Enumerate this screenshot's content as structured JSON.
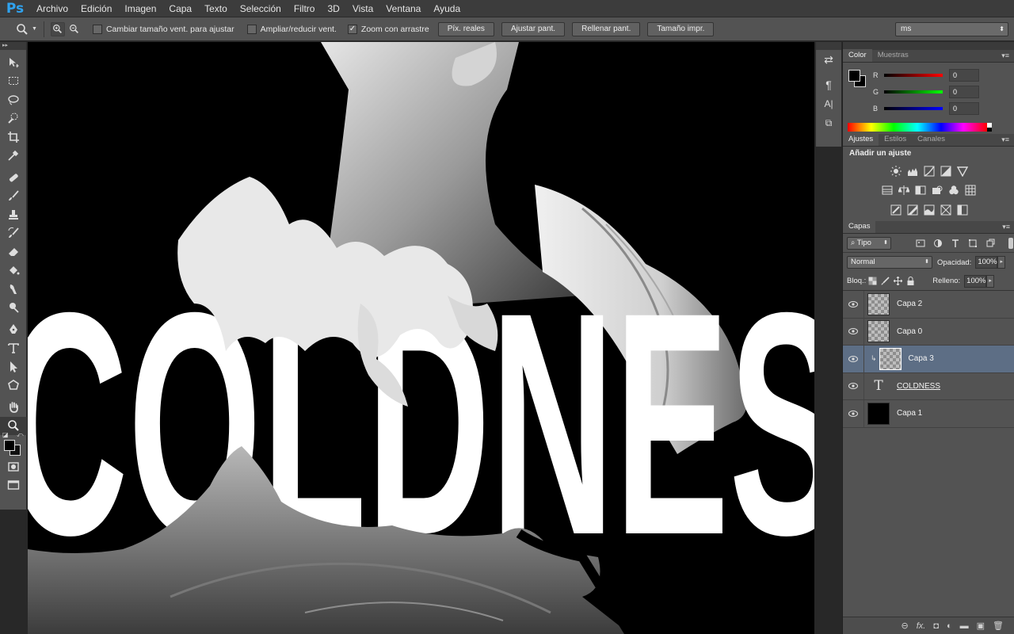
{
  "app": {
    "logo": "Ps"
  },
  "menu": [
    "Archivo",
    "Edición",
    "Imagen",
    "Capa",
    "Texto",
    "Selección",
    "Filtro",
    "3D",
    "Vista",
    "Ventana",
    "Ayuda"
  ],
  "options": {
    "resize_windows": "Cambiar tamaño vent. para ajustar",
    "zoom_all": "Ampliar/reducir vent.",
    "scrubby_zoom": "Zoom con arrastre",
    "buttons": [
      "Píx. reales",
      "Ajustar pant.",
      "Rellenar pant.",
      "Tamaño impr."
    ],
    "workspace_value": "ms"
  },
  "canvas_text": "COLDNES",
  "color_panel": {
    "tabs": [
      "Color",
      "Muestras"
    ],
    "channels": [
      {
        "label": "R",
        "value": "0"
      },
      {
        "label": "G",
        "value": "0"
      },
      {
        "label": "B",
        "value": "0"
      }
    ]
  },
  "adjust_panel": {
    "tabs": [
      "Ajustes",
      "Estilos",
      "Canales"
    ],
    "title": "Añadir un ajuste"
  },
  "layers_panel": {
    "tab": "Capas",
    "filter": "Tipo",
    "blend_mode": "Normal",
    "opacity_label": "Opacidad:",
    "opacity": "100%",
    "lock_label": "Bloq.:",
    "fill_label": "Relleno:",
    "fill": "100%",
    "layers": [
      {
        "name": "Capa 2",
        "kind": "pixel",
        "selected": false
      },
      {
        "name": "Capa 0",
        "kind": "pixel",
        "selected": false
      },
      {
        "name": "Capa 3",
        "kind": "pixel",
        "selected": true
      },
      {
        "name": "COLDNESS",
        "kind": "type",
        "selected": false
      },
      {
        "name": "Capa 1",
        "kind": "black",
        "selected": false
      }
    ],
    "footer_icons": [
      "link-icon",
      "fx-icon",
      "mask-icon",
      "adjustment-icon",
      "group-icon",
      "new-layer-icon",
      "trash-icon"
    ],
    "footer_glyphs": [
      "⊖",
      "fx.",
      "◘",
      "◐",
      "▬",
      "▣",
      "🗑"
    ]
  },
  "colors": {
    "accent_selected": "#5d6e85",
    "panel": "#535353",
    "canvas_bg": "#000000",
    "ps_blue": "#2fa3f0"
  }
}
